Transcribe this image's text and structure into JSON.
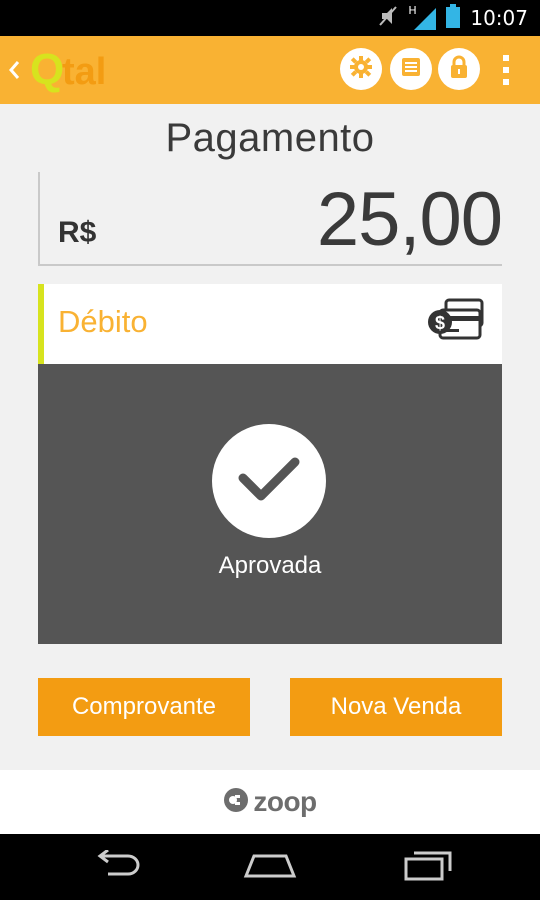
{
  "status_bar": {
    "time": "10:07",
    "network_label": "H",
    "icons": [
      "mute-icon",
      "signal-icon",
      "battery-icon"
    ]
  },
  "action_bar": {
    "logo_text": "Qtal",
    "buttons": [
      "settings-icon",
      "list-icon",
      "lock-icon",
      "overflow-menu-icon"
    ],
    "colors": {
      "bar": "#f9b233",
      "logo_q": "#d7e31e",
      "logo_tal": "#f39c12"
    }
  },
  "payment": {
    "title": "Pagamento",
    "currency": "R$",
    "amount": "25,00"
  },
  "card": {
    "type_label": "Débito",
    "status_label": "Aprovada",
    "colors": {
      "accent": "#d7e31e",
      "label": "#f9b233",
      "body": "#555555"
    }
  },
  "actions": {
    "receipt_label": "Comprovante",
    "new_sale_label": "Nova Venda",
    "button_color": "#f39c12"
  },
  "footer": {
    "brand": "zoop"
  }
}
